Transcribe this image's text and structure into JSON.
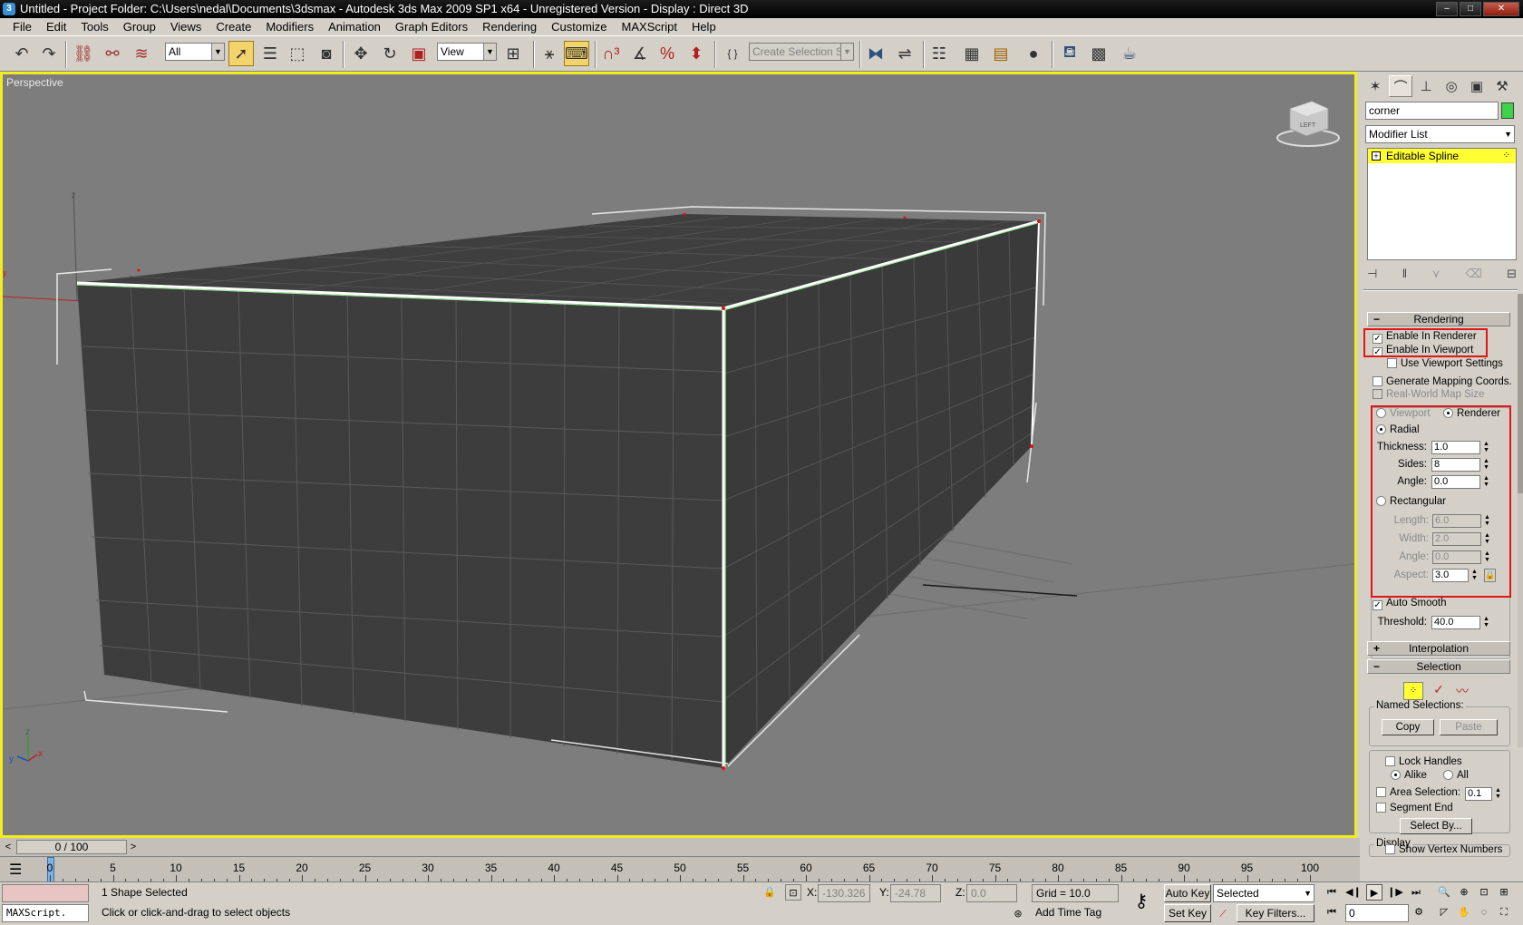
{
  "window": {
    "title": "Untitled      - Project Folder: C:\\Users\\nedal\\Documents\\3dsmax      - Autodesk 3ds Max  2009 SP1  x64   - Unregistered Version      - Display : Direct 3D",
    "app_icon": "3ds-max-logo",
    "minimize": "–",
    "maximize": "□",
    "close": "✕"
  },
  "menu": [
    "File",
    "Edit",
    "Tools",
    "Group",
    "Views",
    "Create",
    "Modifiers",
    "Animation",
    "Graph Editors",
    "Rendering",
    "Customize",
    "MAXScript",
    "Help"
  ],
  "toolbar": {
    "selection_filter": "All",
    "reference_coord": "View",
    "named_selection_placeholder": "Create Selection Set",
    "icons": [
      "undo-icon",
      "redo-icon",
      "select-and-link-icon",
      "unlink-icon",
      "bind-to-space-warp-icon",
      "select-object-icon",
      "select-by-name-icon",
      "rectangular-selection-icon",
      "window-crossing-icon",
      "select-and-move-icon",
      "select-and-rotate-icon",
      "select-and-scale-icon",
      "use-pivot-center-icon",
      "select-and-manipulate-icon",
      "keyboard-shortcut-override-icon",
      "snaps-toggle-icon",
      "angle-snap-icon",
      "percent-snap-icon",
      "spinner-snap-icon",
      "edit-named-selection-icon",
      "mirror-icon",
      "align-icon",
      "layer-manager-icon",
      "curve-editor-icon",
      "schematic-view-icon",
      "material-editor-icon",
      "render-setup-icon",
      "rendered-frame-window-icon",
      "render-production-icon"
    ]
  },
  "viewport": {
    "label": "Perspective",
    "viewcube_label": "LEFT",
    "axis_x": "x",
    "axis_y": "y",
    "axis_z": "z",
    "border_color": "#f3ec20",
    "background": "#7d7d7d"
  },
  "command_panel": {
    "tabs": [
      "create-tab-icon",
      "modify-tab-icon",
      "hierarchy-tab-icon",
      "motion-tab-icon",
      "display-tab-icon",
      "utilities-tab-icon"
    ],
    "object_name": "corner",
    "object_color": "#3cd24a",
    "modifier_list": "Modifier List",
    "stack": [
      {
        "label": "Editable Spline",
        "expand": "+",
        "dots": "⁘"
      }
    ],
    "stack_tools": [
      "pin-stack-icon",
      "show-end-result-icon",
      "make-unique-icon",
      "remove-modifier-icon",
      "configure-modifier-sets-icon"
    ],
    "rendering": {
      "header": "Rendering",
      "sign": "−",
      "enable_in_renderer": "Enable In Renderer",
      "enable_in_viewport": "Enable In Viewport",
      "use_viewport_settings": "Use Viewport Settings",
      "generate_mapping": "Generate Mapping Coords.",
      "real_world": "Real-World Map Size",
      "viewport_radio": "Viewport",
      "renderer_radio": "Renderer",
      "radial": "Radial",
      "thickness_label": "Thickness:",
      "thickness": "1.0",
      "sides_label": "Sides:",
      "sides": "8",
      "angle_label": "Angle:",
      "angle": "0.0",
      "rectangular": "Rectangular",
      "length_label": "Length:",
      "length": "6.0",
      "width_label": "Width:",
      "width": "2.0",
      "rect_angle_label": "Angle:",
      "rect_angle": "0.0",
      "aspect_label": "Aspect:",
      "aspect": "3.0",
      "auto_smooth": "Auto Smooth",
      "threshold_label": "Threshold:",
      "threshold": "40.0"
    },
    "interpolation": {
      "header": "Interpolation",
      "sign": "+"
    },
    "selection": {
      "header": "Selection",
      "sign": "−",
      "named_selections": "Named Selections:",
      "copy": "Copy",
      "paste": "Paste",
      "lock_handles": "Lock Handles",
      "alike": "Alike",
      "all": "All",
      "area_selection": "Area Selection:",
      "area_value": "0.1",
      "segment_end": "Segment End",
      "select_by": "Select By...",
      "display": "Display",
      "show_vertex_numbers": "Show Vertex Numbers"
    },
    "highlight_color": "#e01515"
  },
  "timeline": {
    "frame_display": "0 / 100",
    "prev": "<",
    "next": ">",
    "ticks": [
      "0",
      "5",
      "10",
      "15",
      "20",
      "25",
      "30",
      "35",
      "40",
      "45",
      "50",
      "55",
      "60",
      "65",
      "70",
      "75",
      "80",
      "85",
      "90",
      "95",
      "100"
    ]
  },
  "status": {
    "selected_text": "1 Shape Selected",
    "prompt": "Click or click-and-drag to select objects",
    "maxscript": "MAXScript.",
    "x_label": "X:",
    "x": "-130.326",
    "y_label": "Y:",
    "y": "-24.78",
    "z_label": "Z:",
    "z": "0.0",
    "grid": "Grid = 10.0",
    "add_time_tag": "Add Time Tag",
    "auto_key": "Auto Key",
    "set_key": "Set Key",
    "key_mode": "Selected",
    "key_filters": "Key Filters...",
    "current_frame": "0"
  }
}
